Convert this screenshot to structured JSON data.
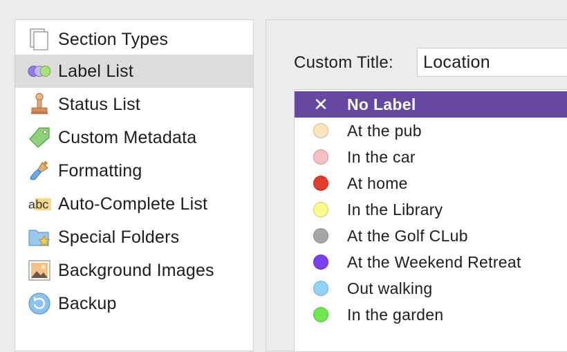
{
  "sidebar": {
    "items": [
      {
        "label": "Section Types",
        "icon": "documents-icon",
        "selected": false
      },
      {
        "label": "Label List",
        "icon": "label-circles-icon",
        "selected": true
      },
      {
        "label": "Status List",
        "icon": "stamp-icon",
        "selected": false
      },
      {
        "label": "Custom Metadata",
        "icon": "tag-icon",
        "selected": false
      },
      {
        "label": "Formatting",
        "icon": "paintbrush-icon",
        "selected": false
      },
      {
        "label": "Auto-Complete List",
        "icon": "abc-icon",
        "selected": false
      },
      {
        "label": "Special Folders",
        "icon": "star-folder-icon",
        "selected": false
      },
      {
        "label": "Background Images",
        "icon": "picture-icon",
        "selected": false
      },
      {
        "label": "Backup",
        "icon": "backup-icon",
        "selected": false
      }
    ]
  },
  "panel": {
    "title_label": "Custom Title:",
    "title_value": "Location"
  },
  "labels": [
    {
      "label": "No Label",
      "color": null,
      "selected": true
    },
    {
      "label": "At the pub",
      "color": "#fbe5bd",
      "selected": false
    },
    {
      "label": "In the car",
      "color": "#f6c1c6",
      "selected": false
    },
    {
      "label": "At home",
      "color": "#e53b2b",
      "selected": false
    },
    {
      "label": "In the Library",
      "color": "#fbfb8c",
      "selected": false
    },
    {
      "label": "At the Golf CLub",
      "color": "#a6a6a6",
      "selected": false
    },
    {
      "label": "At the Weekend Retreat",
      "color": "#7c3ff0",
      "selected": false
    },
    {
      "label": "Out walking",
      "color": "#8fd3f7",
      "selected": false
    },
    {
      "label": "In the garden",
      "color": "#6ee64f",
      "selected": false
    }
  ],
  "colors": {
    "selection_purple": "#6548a2",
    "sidebar_selection": "#dcdcdc"
  }
}
